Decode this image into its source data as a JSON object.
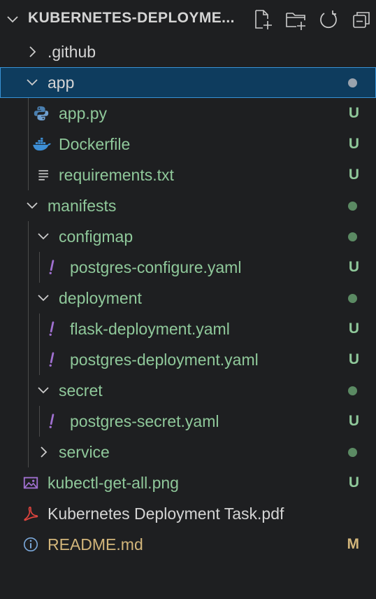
{
  "explorer": {
    "title": "KUBERNETES-DEPLOYME...",
    "actions": [
      {
        "name": "new-file-button",
        "icon": "new-file-icon"
      },
      {
        "name": "new-folder-button",
        "icon": "new-folder-icon"
      },
      {
        "name": "refresh-button",
        "icon": "refresh-icon"
      },
      {
        "name": "collapse-all-button",
        "icon": "collapse-all-icon"
      }
    ]
  },
  "tree": [
    {
      "label": ".github",
      "type": "folder",
      "expanded": false,
      "status": "",
      "color": "white"
    },
    {
      "label": "app",
      "type": "folder",
      "expanded": true,
      "status": "dot",
      "color": "white",
      "selected": true
    },
    {
      "label": "app.py",
      "type": "file",
      "icon": "python-icon",
      "status": "U",
      "color": "green"
    },
    {
      "label": "Dockerfile",
      "type": "file",
      "icon": "docker-icon",
      "status": "U",
      "color": "green"
    },
    {
      "label": "requirements.txt",
      "type": "file",
      "icon": "text-lines-icon",
      "status": "U",
      "color": "green"
    },
    {
      "label": "manifests",
      "type": "folder",
      "expanded": true,
      "status": "dot",
      "color": "green"
    },
    {
      "label": "configmap",
      "type": "folder",
      "expanded": true,
      "status": "dot",
      "color": "green"
    },
    {
      "label": "postgres-configure.yaml",
      "type": "file",
      "icon": "yaml-exclamation-icon",
      "status": "U",
      "color": "green"
    },
    {
      "label": "deployment",
      "type": "folder",
      "expanded": true,
      "status": "dot",
      "color": "green"
    },
    {
      "label": "flask-deployment.yaml",
      "type": "file",
      "icon": "yaml-exclamation-icon",
      "status": "U",
      "color": "green"
    },
    {
      "label": "postgres-deployment.yaml",
      "type": "file",
      "icon": "yaml-exclamation-icon",
      "status": "U",
      "color": "green"
    },
    {
      "label": "secret",
      "type": "folder",
      "expanded": true,
      "status": "dot",
      "color": "green"
    },
    {
      "label": "postgres-secret.yaml",
      "type": "file",
      "icon": "yaml-exclamation-icon",
      "status": "U",
      "color": "green"
    },
    {
      "label": "service",
      "type": "folder",
      "expanded": false,
      "status": "dot",
      "color": "green"
    },
    {
      "label": "kubectl-get-all.png",
      "type": "file",
      "icon": "image-icon",
      "status": "U",
      "color": "green"
    },
    {
      "label": "Kubernetes Deployment Task.pdf",
      "type": "file",
      "icon": "pdf-icon",
      "status": "",
      "color": "white"
    },
    {
      "label": "README.md",
      "type": "file",
      "icon": "info-icon",
      "status": "M",
      "color": "mod"
    }
  ],
  "colors": {
    "background": "#1e1f21",
    "untracked": "#8fc89a",
    "modified": "#d2b57a",
    "selection": "#0e3c5e",
    "selection_border": "#3892d5"
  }
}
